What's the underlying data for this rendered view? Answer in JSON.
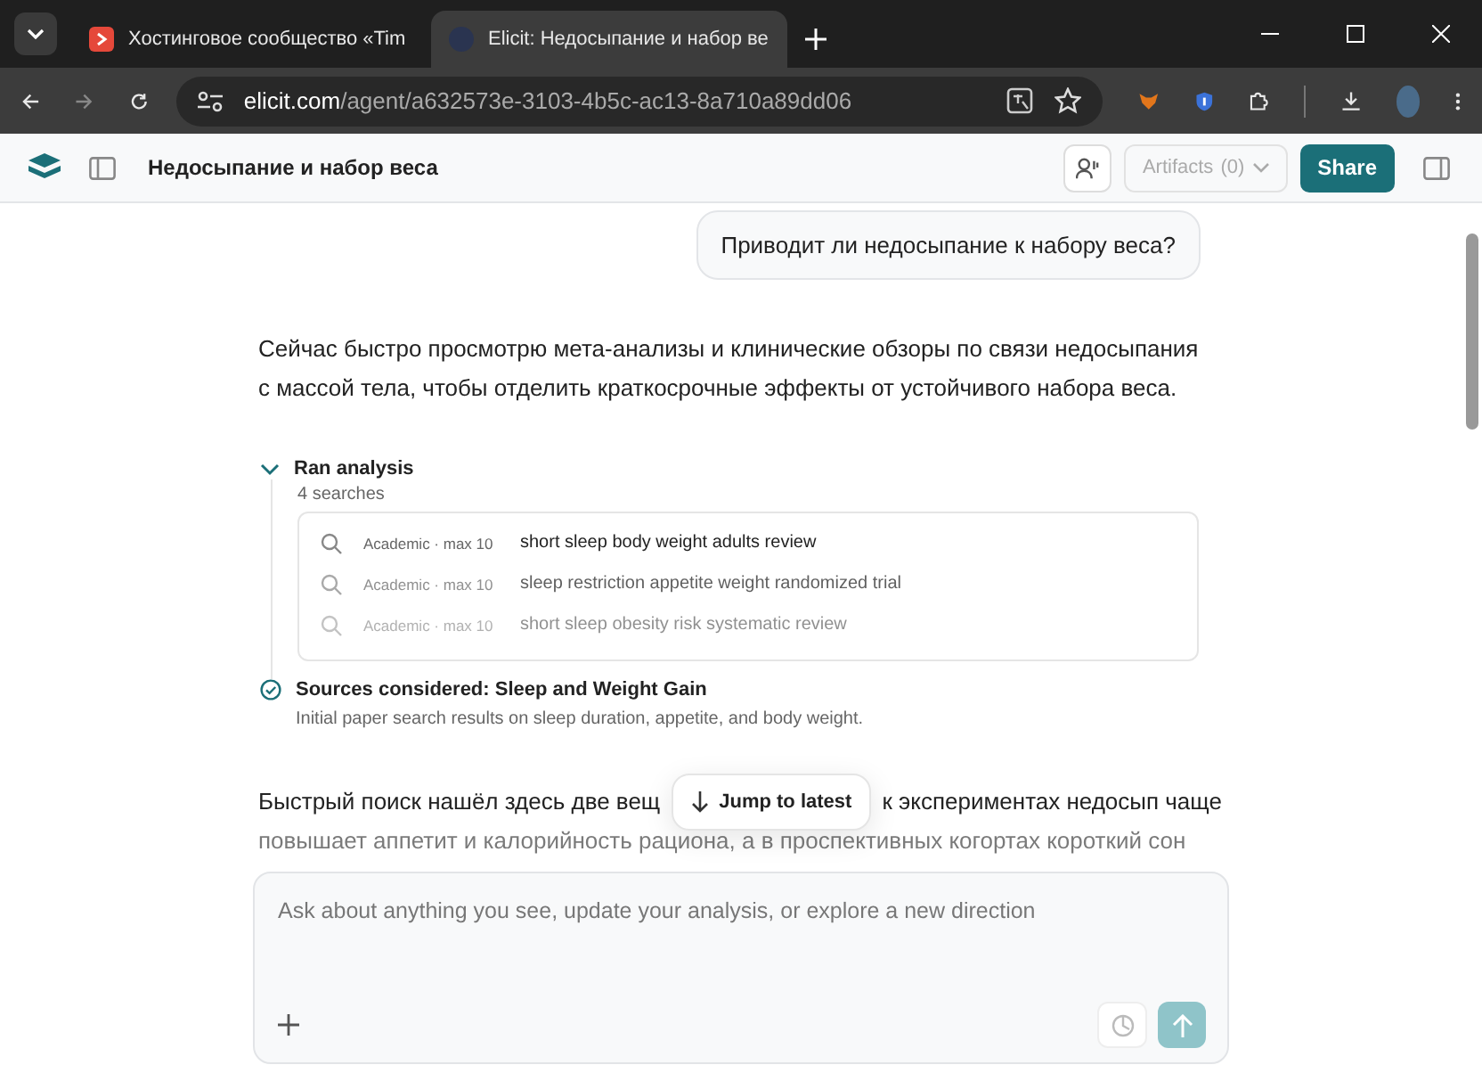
{
  "browser": {
    "tabs": [
      {
        "title": "Хостинговое сообщество «Tim",
        "selected": false
      },
      {
        "title": "Elicit: Недосыпание и набор ве",
        "selected": true
      }
    ],
    "url_host": "elicit.com",
    "url_path": "/agent/a632573e-3103-4b5c-ac13-8a710a89dd06"
  },
  "header": {
    "title": "Недосыпание и набор веса",
    "artifacts": {
      "label": "Artifacts",
      "count": "(0)",
      "disabled": true
    },
    "share": "Share"
  },
  "user_message": "Приводит ли недосыпание к набору веса?",
  "assistant_intro": "Сейчас быстро просмотрю мета-анализы и клинические обзоры по связи недосыпания с массой тела, чтобы отделить краткосрочные эффекты от устойчивого набора веса.",
  "analysis": {
    "title": "Ran analysis",
    "expanded": true,
    "subtitle": "4 searches",
    "searches": [
      {
        "source": "Academic · max 10",
        "query": "short sleep body weight adults review",
        "kind": "normal"
      },
      {
        "source": "Academic · max 10",
        "query": "sleep restriction appetite weight randomized trial",
        "kind": "muted"
      },
      {
        "source": "Academic · max 10",
        "query": "short sleep obesity risk systematic review",
        "kind": "faint"
      }
    ]
  },
  "sources": {
    "title": "Sources considered: Sleep and Weight Gain",
    "description": "Initial paper search results on sleep duration, appetite, and body weight.",
    "done": true
  },
  "answer_lines": [
    [
      "Быстрый поиск нашёл здесь две вещ",
      "к экспериментах недосып чаще"
    ],
    [
      "повышает аппетит и калорийность рациона, а в проспективных когортах короткий сон"
    ]
  ],
  "jump_button": "Jump to latest",
  "composer": {
    "placeholder": "Ask about anything you see, update your analysis, or explore a new direction"
  }
}
